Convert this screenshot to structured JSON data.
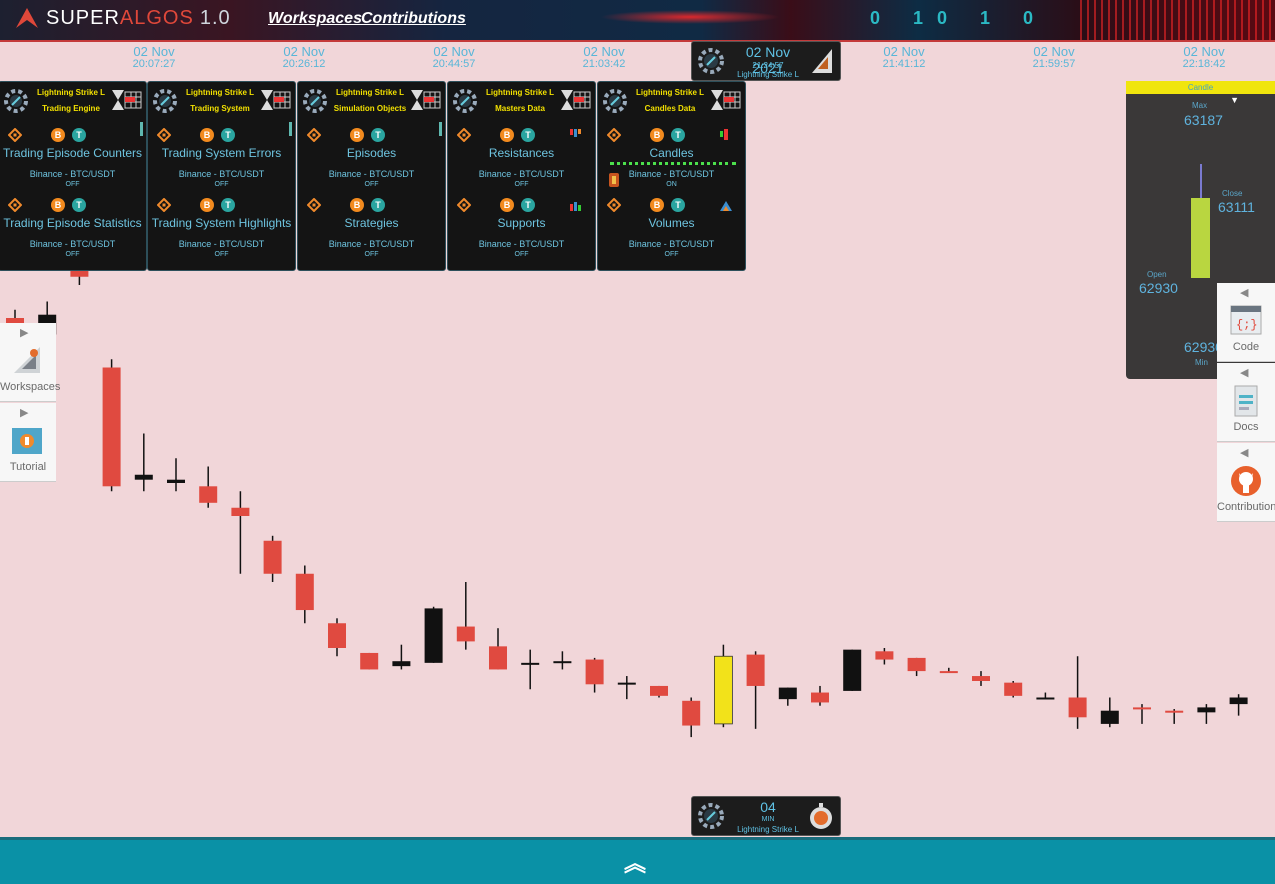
{
  "header": {
    "logo_super": "SUPER",
    "logo_algos": "ALGOS",
    "logo_version": "1.0",
    "nav_workspaces": "Workspaces",
    "nav_contributions": "Contributions",
    "binary_decor": "0 10 1 0"
  },
  "time_labels": [
    {
      "date": "02 Nov",
      "time": "20:07:27"
    },
    {
      "date": "02 Nov",
      "time": "20:26:12"
    },
    {
      "date": "02 Nov",
      "time": "20:44:57"
    },
    {
      "date": "02 Nov",
      "time": "21:03:42"
    },
    {
      "date": "02 Nov",
      "time": "21:41:12"
    },
    {
      "date": "02 Nov",
      "time": "21:59:57"
    },
    {
      "date": "02 Nov",
      "time": "22:18:42"
    }
  ],
  "cursor": {
    "date": "02 Nov 2021",
    "time": "21:24:57",
    "label": "Lightning Strike L"
  },
  "panels": [
    {
      "title1": "Lightning Strike L",
      "title2": "Trading Engine",
      "layers": [
        {
          "name": "Trading Episode Counters",
          "market": "Binance - BTC/USDT",
          "status": "OFF"
        },
        {
          "name": "Trading Episode Statistics",
          "market": "Binance - BTC/USDT",
          "status": "OFF"
        }
      ]
    },
    {
      "title1": "Lightning Strike L",
      "title2": "Trading System",
      "layers": [
        {
          "name": "Trading System Errors",
          "market": "Binance - BTC/USDT",
          "status": "OFF"
        },
        {
          "name": "Trading System Highlights",
          "market": "Binance - BTC/USDT",
          "status": "OFF"
        }
      ]
    },
    {
      "title1": "Lightning Strike L",
      "title2": "Simulation Objects",
      "layers": [
        {
          "name": "Episodes",
          "market": "Binance - BTC/USDT",
          "status": "OFF"
        },
        {
          "name": "Strategies",
          "market": "Binance - BTC/USDT",
          "status": "OFF"
        }
      ]
    },
    {
      "title1": "Lightning Strike L",
      "title2": "Masters Data",
      "layers": [
        {
          "name": "Resistances",
          "market": "Binance - BTC/USDT",
          "status": "OFF"
        },
        {
          "name": "Supports",
          "market": "Binance - BTC/USDT",
          "status": "OFF"
        }
      ]
    },
    {
      "title1": "Lightning Strike L",
      "title2": "Candles Data",
      "layers": [
        {
          "name": "Candles",
          "market": "Binance - BTC/USDT",
          "status": "ON"
        },
        {
          "name": "Volumes",
          "market": "Binance - BTC/USDT",
          "status": "OFF"
        }
      ]
    }
  ],
  "coins": {
    "btc": "B",
    "usdt": "T"
  },
  "candle_info": {
    "header": "Candle",
    "max_label": "Max",
    "max": "63187",
    "close_label": "Close",
    "close": "63111",
    "open_label": "Open",
    "open": "62930",
    "min_label": "Min",
    "min": "62930"
  },
  "left_tabs": [
    {
      "label": "Workspaces"
    },
    {
      "label": "Tutorial"
    }
  ],
  "right_tabs": [
    {
      "label": "Code"
    },
    {
      "label": "Docs"
    },
    {
      "label": "Contributions"
    }
  ],
  "timeframe": {
    "value": "04",
    "unit": "MIN",
    "label": "Lightning Strike L"
  },
  "colors": {
    "bull": "#e04a40",
    "bear": "#111111",
    "highlight": "#f2e21a",
    "bar_bottom": "#0a91a6"
  },
  "chart_data": {
    "type": "candlestick",
    "candles": [
      {
        "o": 62950,
        "h": 62955,
        "l": 62940,
        "c": 62930
      },
      {
        "o": 62940,
        "h": 62960,
        "l": 62930,
        "c": 62952
      },
      {
        "o": 62990,
        "h": 63010,
        "l": 62970,
        "c": 62975
      },
      {
        "o": 62920,
        "h": 62925,
        "l": 62845,
        "c": 62848
      },
      {
        "o": 62852,
        "h": 62880,
        "l": 62845,
        "c": 62855
      },
      {
        "o": 62850,
        "h": 62865,
        "l": 62845,
        "c": 62852
      },
      {
        "o": 62848,
        "h": 62860,
        "l": 62835,
        "c": 62838
      },
      {
        "o": 62835,
        "h": 62845,
        "l": 62795,
        "c": 62830
      },
      {
        "o": 62815,
        "h": 62818,
        "l": 62790,
        "c": 62795
      },
      {
        "o": 62795,
        "h": 62800,
        "l": 62765,
        "c": 62773
      },
      {
        "o": 62765,
        "h": 62768,
        "l": 62745,
        "c": 62750
      },
      {
        "o": 62747,
        "h": 62747,
        "l": 62737,
        "c": 62737
      },
      {
        "o": 62739,
        "h": 62752,
        "l": 62737,
        "c": 62742
      },
      {
        "o": 62741,
        "h": 62775,
        "l": 62741,
        "c": 62774
      },
      {
        "o": 62763,
        "h": 62790,
        "l": 62749,
        "c": 62754
      },
      {
        "o": 62751,
        "h": 62762,
        "l": 62737,
        "c": 62737
      },
      {
        "o": 62740,
        "h": 62749,
        "l": 62725,
        "c": 62741
      },
      {
        "o": 62741,
        "h": 62748,
        "l": 62737,
        "c": 62742
      },
      {
        "o": 62743,
        "h": 62744,
        "l": 62723,
        "c": 62728
      },
      {
        "o": 62729,
        "h": 62733,
        "l": 62719,
        "c": 62729
      },
      {
        "o": 62727,
        "h": 62727,
        "l": 62720,
        "c": 62721
      },
      {
        "o": 62718,
        "h": 62720,
        "l": 62696,
        "c": 62703
      },
      {
        "o": 62704,
        "h": 62752,
        "l": 62702,
        "c": 62745
      },
      {
        "o": 62746,
        "h": 62748,
        "l": 62701,
        "c": 62727
      },
      {
        "o": 62719,
        "h": 62726,
        "l": 62715,
        "c": 62726
      },
      {
        "o": 62723,
        "h": 62727,
        "l": 62715,
        "c": 62717
      },
      {
        "o": 62724,
        "h": 62749,
        "l": 62724,
        "c": 62749
      },
      {
        "o": 62748,
        "h": 62750,
        "l": 62740,
        "c": 62743
      },
      {
        "o": 62744,
        "h": 62744,
        "l": 62733,
        "c": 62736
      },
      {
        "o": 62736,
        "h": 62738,
        "l": 62735,
        "c": 62735
      },
      {
        "o": 62733,
        "h": 62736,
        "l": 62727,
        "c": 62730
      },
      {
        "o": 62729,
        "h": 62730,
        "l": 62720,
        "c": 62721
      },
      {
        "o": 62720,
        "h": 62723,
        "l": 62720,
        "c": 62720
      },
      {
        "o": 62720,
        "h": 62745,
        "l": 62701,
        "c": 62708
      },
      {
        "o": 62704,
        "h": 62720,
        "l": 62702,
        "c": 62712
      },
      {
        "o": 62714,
        "h": 62716,
        "l": 62704,
        "c": 62713
      },
      {
        "o": 62712,
        "h": 62713,
        "l": 62704,
        "c": 62711
      },
      {
        "o": 62711,
        "h": 62716,
        "l": 62704,
        "c": 62714
      },
      {
        "o": 62716,
        "h": 62722,
        "l": 62709,
        "c": 62720
      }
    ]
  }
}
